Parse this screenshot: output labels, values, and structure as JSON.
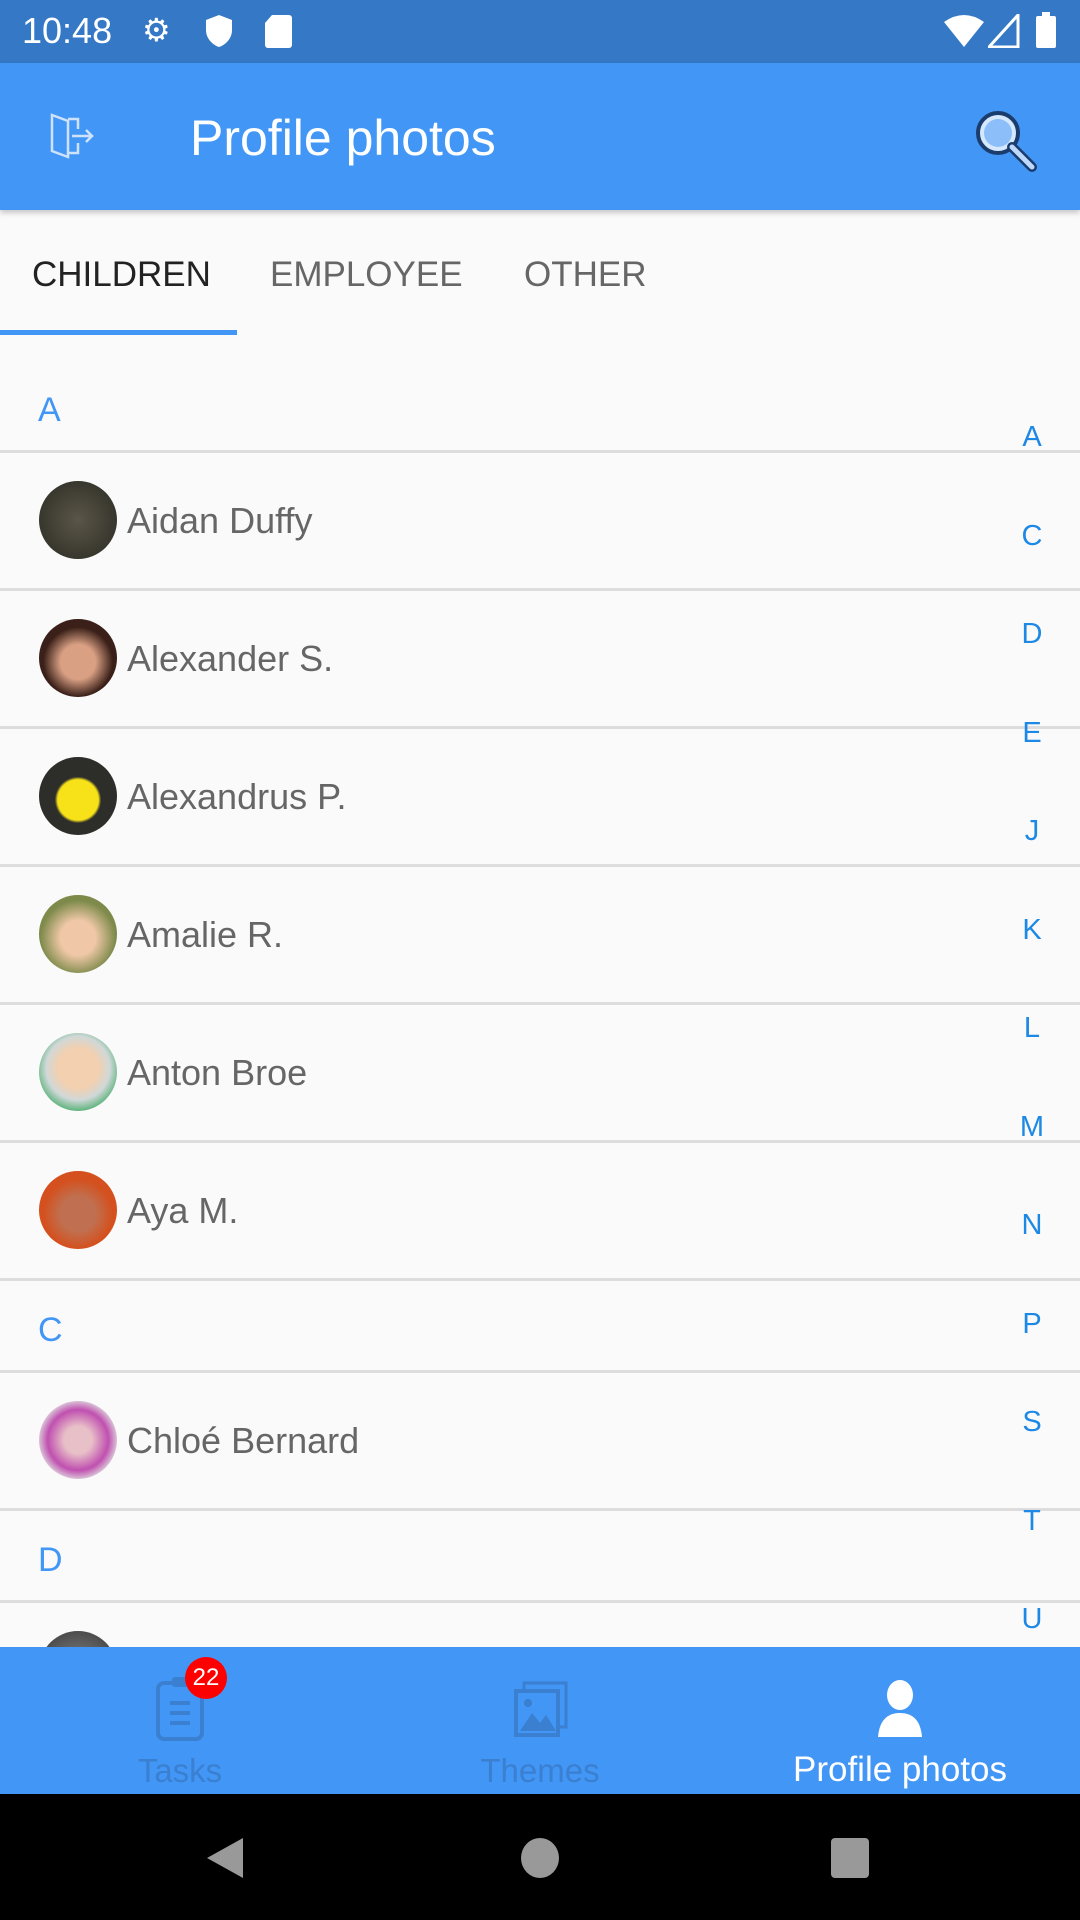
{
  "status_bar": {
    "time": "10:48",
    "icons": [
      "gear-icon",
      "shield-icon",
      "sd-card-icon",
      "wifi-icon",
      "signal-icon",
      "battery-icon"
    ]
  },
  "app_bar": {
    "title": "Profile photos",
    "left_icon": "exit-door-icon",
    "right_icon": "search-icon"
  },
  "tabs": [
    {
      "label": "CHILDREN",
      "active": true
    },
    {
      "label": "EMPLOYEE",
      "active": false
    },
    {
      "label": "OTHER",
      "active": false
    }
  ],
  "sections": [
    {
      "letter": "A",
      "items": [
        {
          "name": "Aidan Duffy"
        },
        {
          "name": "Alexander S."
        },
        {
          "name": "Alexandrus P."
        },
        {
          "name": "Amalie R."
        },
        {
          "name": "Anton Broe"
        },
        {
          "name": "Aya M."
        }
      ]
    },
    {
      "letter": "C",
      "items": [
        {
          "name": "Chloé Bernard"
        }
      ]
    },
    {
      "letter": "D",
      "items": [
        {
          "name": ""
        }
      ]
    }
  ],
  "index_letters": [
    "A",
    "C",
    "D",
    "E",
    "J",
    "K",
    "L",
    "M",
    "N",
    "P",
    "S",
    "T",
    "U"
  ],
  "bottom_nav": [
    {
      "label": "Tasks",
      "icon": "clipboard-icon",
      "badge": "22"
    },
    {
      "label": "Themes",
      "icon": "images-icon"
    },
    {
      "label": "Profile photos",
      "icon": "person-icon",
      "active": true
    }
  ],
  "colors": {
    "primary": "#4296f5",
    "status_bar": "#3478c6",
    "accent_text": "#1e88e5",
    "badge": "#ff0000"
  }
}
